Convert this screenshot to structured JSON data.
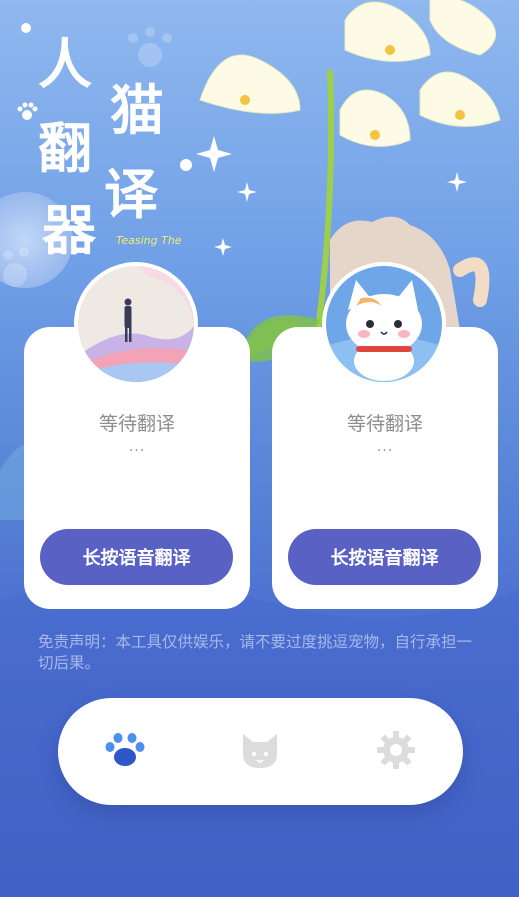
{
  "app": {
    "title": "人猫翻译器",
    "title_chars": [
      "人",
      "猫",
      "翻",
      "译",
      "器"
    ],
    "tagline": "Teasing The"
  },
  "panels": [
    {
      "status": "等待翻译",
      "ellipsis": "...",
      "button_label": "长按语音翻译"
    },
    {
      "status": "等待翻译",
      "ellipsis": "...",
      "button_label": "长按语音翻译"
    }
  ],
  "disclaimer": "免责声明：本工具仅供娱乐，请不要过度挑逗宠物，自行承担一切后果。",
  "tabbar": {
    "tabs": [
      {
        "icon": "paw-icon",
        "active": true
      },
      {
        "icon": "cat-face-icon",
        "active": false
      },
      {
        "icon": "gear-icon",
        "active": false
      }
    ]
  },
  "colors": {
    "accent": "#5961c4",
    "card": "#ffffff",
    "active_icon": "#3d6be0",
    "inactive_icon": "#dcdcdc",
    "status_text": "#8e8e8e"
  }
}
